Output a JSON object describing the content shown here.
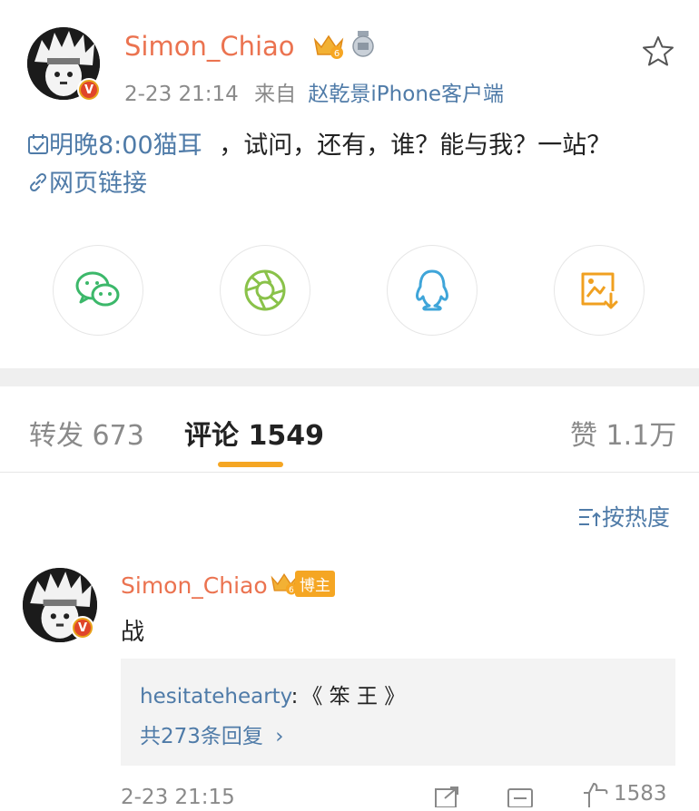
{
  "post": {
    "author": "Simon_Chiao",
    "time": "2-23 21:14",
    "source_prefix": "来自",
    "source": "赵乾景iPhone客户端",
    "event_link": "明晚8:00猫耳",
    "text": "，试问，还有，谁？能与我？一站？",
    "web_link": "网页链接"
  },
  "share": {
    "items": [
      {
        "name": "wechat",
        "icon": "wechat-icon"
      },
      {
        "name": "moments",
        "icon": "moments-icon"
      },
      {
        "name": "qq",
        "icon": "qq-icon"
      },
      {
        "name": "save-image",
        "icon": "save-image-icon"
      }
    ],
    "colors": {
      "wechat": "#3cb86a",
      "moments": "#8ac24a",
      "qq": "#3fa5d9",
      "save": "#f0a020"
    }
  },
  "tabs": {
    "repost_label": "转发",
    "repost_count": "673",
    "comment_label": "评论",
    "comment_count": "1549",
    "like_label": "赞",
    "like_count": "1.1万"
  },
  "sort": {
    "label": "按热度"
  },
  "comment": {
    "author": "Simon_Chiao",
    "badge": "博主",
    "text": "战",
    "reply_user": "hesitatehearty",
    "reply_colon": ":",
    "reply_text": "《 笨 王 》",
    "reply_count_label": "共273条回复",
    "time": "2-23 21:15",
    "like_count": "1583"
  },
  "colors": {
    "accent": "#eb7350",
    "link": "#4f7ba8",
    "underline": "#f5a623",
    "divider": "#efefef"
  }
}
